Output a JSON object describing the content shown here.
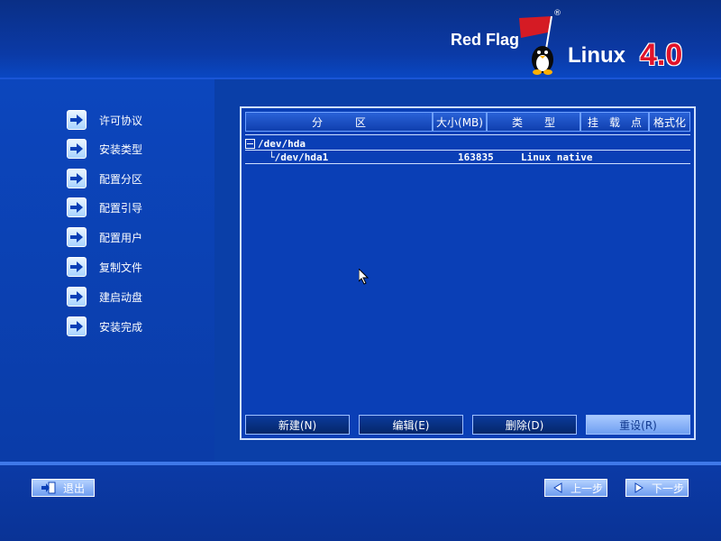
{
  "logo": {
    "brand": "Red Flag",
    "product": "Linux",
    "version": "4.0",
    "registered": "®"
  },
  "sidebar": {
    "items": [
      {
        "label": "许可协议"
      },
      {
        "label": "安装类型"
      },
      {
        "label": "配置分区"
      },
      {
        "label": "配置引导"
      },
      {
        "label": "配置用户"
      },
      {
        "label": "复制文件"
      },
      {
        "label": "建启动盘"
      },
      {
        "label": "安装完成"
      }
    ]
  },
  "partition_table": {
    "columns": [
      "分　　　区",
      "大小(MB)",
      "类　　型",
      "挂　载　点",
      "格式化"
    ],
    "rows": [
      {
        "name": "/dev/hda",
        "size": "",
        "type": ""
      },
      {
        "name": "└/dev/hda1",
        "size": "163835",
        "type": "Linux native"
      }
    ]
  },
  "panel_buttons": {
    "new": "新建(N)",
    "edit": "编辑(E)",
    "delete": "删除(D)",
    "reset": "重设(R)"
  },
  "footer": {
    "exit": "退出",
    "prev": "上一步",
    "next": "下一步"
  },
  "colors": {
    "background": "#0a3fa8",
    "accent_red": "#e1122a",
    "panel": "#0a3fb6"
  }
}
